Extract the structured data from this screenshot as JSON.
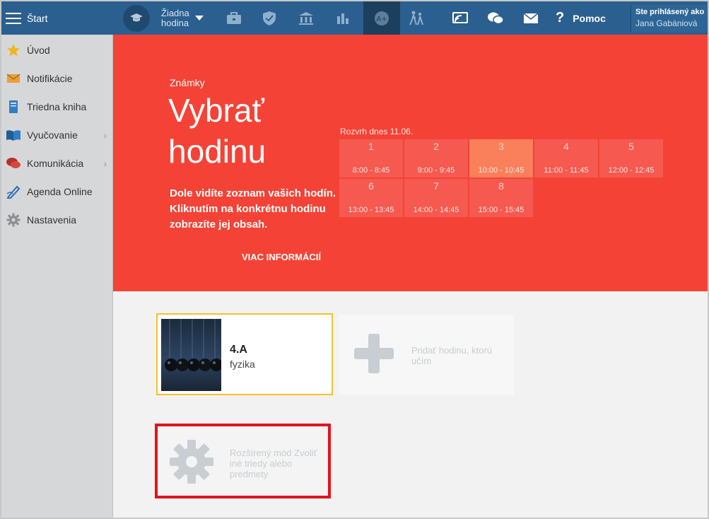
{
  "topbar": {
    "start_label": "Štart",
    "lesson_label_line1": "Žiadna",
    "lesson_label_line2": "hodina",
    "help_label": "Pomoc",
    "user_label": "Ste prihlásený ako",
    "user_name": "Jana Gabániová"
  },
  "sidebar": {
    "items": [
      {
        "label": "Úvod",
        "icon": "star-icon"
      },
      {
        "label": "Notifikácie",
        "icon": "envelope-icon"
      },
      {
        "label": "Triedna kniha",
        "icon": "book-icon"
      },
      {
        "label": "Vyučovanie",
        "icon": "open-book-icon",
        "arrow": "›"
      },
      {
        "label": "Komunikácia",
        "icon": "chat-icon",
        "arrow": "›"
      },
      {
        "label": "Agenda Online",
        "icon": "pen-icon"
      },
      {
        "label": "Nastavenia",
        "icon": "gear-icon"
      }
    ]
  },
  "hero": {
    "kicker": "Známky",
    "title": "Vybrať hodinu",
    "description": "Dole vidíte zoznam vašich hodín. Kliknutím na konkrétnu hodinu zobrazíte jej obsah.",
    "more_link": "VIAC INFORMÁCIÍ"
  },
  "schedule": {
    "title": "Rozvrh dnes 11.06.",
    "slots": [
      {
        "num": "1",
        "time": "8:00 - 8:45"
      },
      {
        "num": "2",
        "time": "9:00 - 9:45"
      },
      {
        "num": "3",
        "time": "10:00 - 10:45"
      },
      {
        "num": "4",
        "time": "11:00 - 11:45"
      },
      {
        "num": "5",
        "time": "12:00 - 12:45"
      },
      {
        "num": "6",
        "time": "13:00 - 13:45"
      },
      {
        "num": "7",
        "time": "14:00 - 14:45"
      },
      {
        "num": "8",
        "time": "15:00 - 15:45"
      }
    ]
  },
  "cards": {
    "class_name": "4.A",
    "class_subject": "fyzika",
    "add_text": "Pridať hodinu, ktorú učím",
    "mode_text": "Rozšírený mód Zvoliť iné triedy alebo predmety"
  },
  "colors": {
    "topbar": "#2b5f8f",
    "hero": "#f44336",
    "highlight_border": "#e0141f",
    "selected_border": "#f2c22b"
  }
}
